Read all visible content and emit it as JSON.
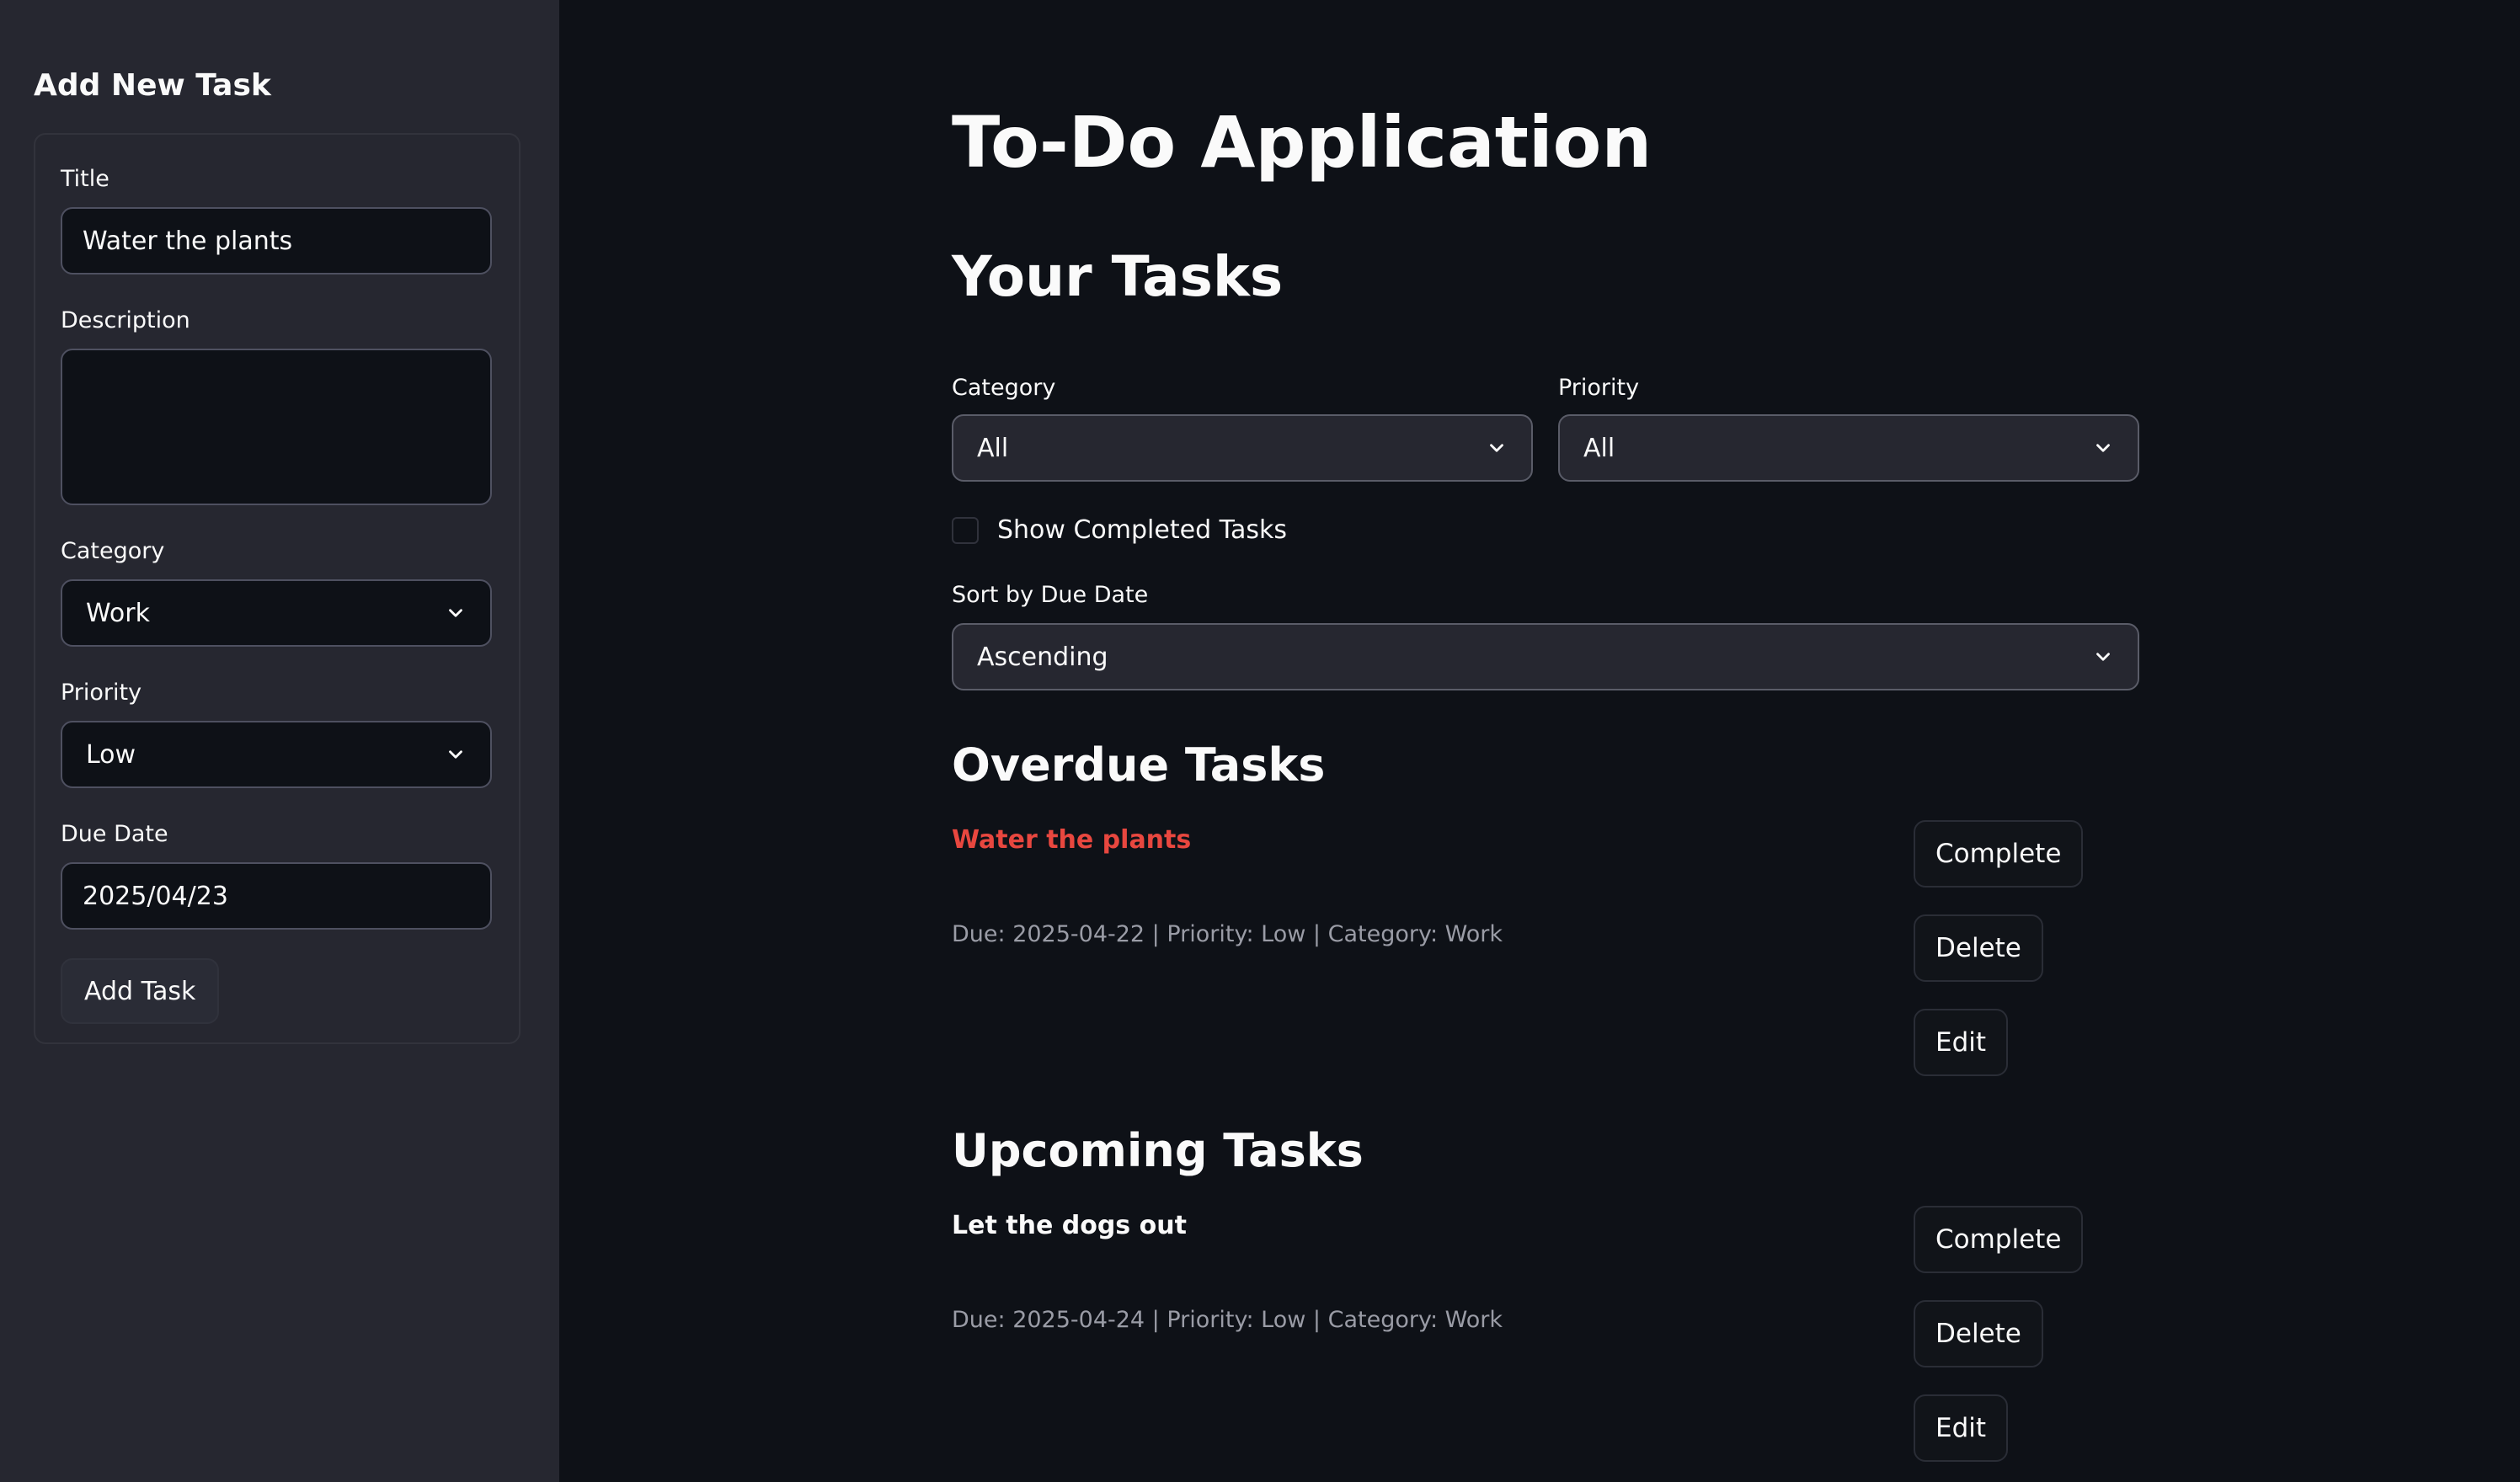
{
  "sidebar": {
    "title": "Add New Task",
    "title_label": "Title",
    "title_value": "Water the plants",
    "description_label": "Description",
    "description_value": "",
    "category_label": "Category",
    "category_value": "Work",
    "priority_label": "Priority",
    "priority_value": "Low",
    "due_date_label": "Due Date",
    "due_date_value": "2025/04/23",
    "add_button_label": "Add Task"
  },
  "main": {
    "app_title": "To-Do Application",
    "section_title": "Your Tasks",
    "filters": {
      "category_label": "Category",
      "category_value": "All",
      "priority_label": "Priority",
      "priority_value": "All",
      "show_completed_label": "Show Completed Tasks",
      "show_completed_checked": false,
      "sort_label": "Sort by Due Date",
      "sort_value": "Ascending"
    },
    "overdue": {
      "heading": "Overdue Tasks",
      "tasks": [
        {
          "title": "Water the plants",
          "meta": "Due: 2025-04-22 | Priority: Low | Category: Work",
          "complete_label": "Complete",
          "delete_label": "Delete",
          "edit_label": "Edit"
        }
      ]
    },
    "upcoming": {
      "heading": "Upcoming Tasks",
      "tasks": [
        {
          "title": "Let the dogs out",
          "meta": "Due: 2025-04-24 | Priority: Low | Category: Work",
          "complete_label": "Complete",
          "delete_label": "Delete",
          "edit_label": "Edit"
        }
      ]
    }
  },
  "colors": {
    "background": "#0e1117",
    "sidebar": "#262730",
    "overdue_title": "#e8473f",
    "muted_text": "#9a9ca6"
  },
  "icons": {
    "select_arrow": "chevron-down-icon"
  }
}
